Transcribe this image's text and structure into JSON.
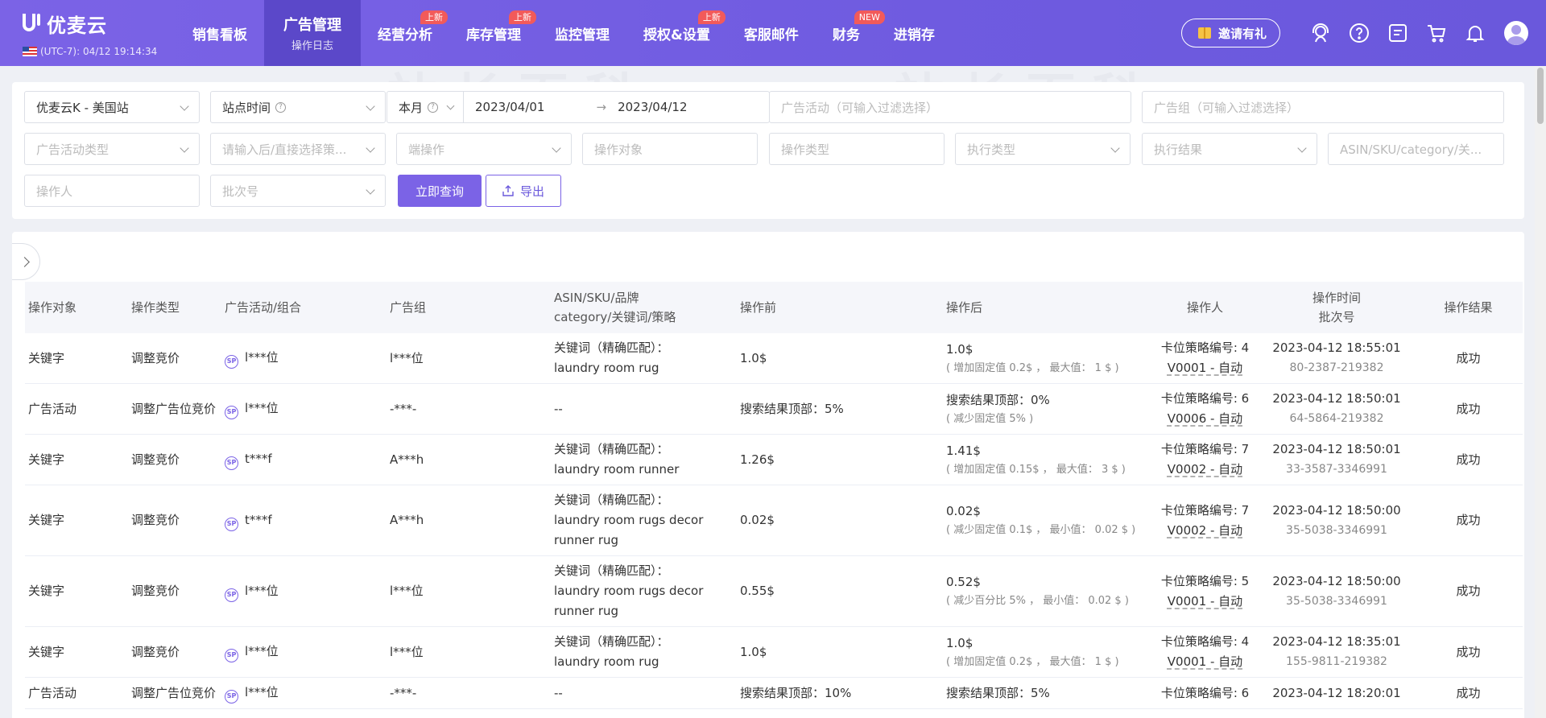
{
  "brand": {
    "name": "优麦云",
    "timezone": "(UTC-7): 04/12 19:14:34"
  },
  "nav": [
    {
      "label": "销售看板",
      "badge": ""
    },
    {
      "label": "广告管理",
      "sub": "操作日志",
      "active": true
    },
    {
      "label": "经营分析",
      "badge": "上新"
    },
    {
      "label": "库存管理",
      "badge": "上新"
    },
    {
      "label": "监控管理",
      "badge": ""
    },
    {
      "label": "授权&设置",
      "badge": "上新"
    },
    {
      "label": "客服邮件",
      "badge": ""
    },
    {
      "label": "财务",
      "badge": "NEW"
    },
    {
      "label": "进销存",
      "badge": ""
    }
  ],
  "top_right": {
    "invite": "邀请有礼",
    "icons": [
      "support-icon",
      "help-icon",
      "message-icon",
      "cart-icon",
      "bell-icon",
      "user-avatar"
    ]
  },
  "filters": {
    "store": "优麦云K - 美国站",
    "time_type": "站点时间",
    "period": "本月",
    "date_start": "2023/04/01",
    "date_end": "2023/04/12",
    "campaign_placeholder": "广告活动（可输入过滤选择）",
    "group_placeholder": "广告组（可输入过滤选择）",
    "campaign_type_placeholder": "广告活动类型",
    "strategy_placeholder": "请输入后/直接选择策...",
    "endpoint_placeholder": "端操作",
    "target_placeholder": "操作对象",
    "op_type_placeholder": "操作类型",
    "exec_type_placeholder": "执行类型",
    "exec_result_placeholder": "执行结果",
    "asin_placeholder": "ASIN/SKU/category/关...",
    "operator_placeholder": "操作人",
    "batch_placeholder": "批次号",
    "query_button": "立即查询",
    "export_button": "导出"
  },
  "table": {
    "headers": {
      "target": "操作对象",
      "op_type": "操作类型",
      "campaign": "广告活动/组合",
      "group": "广告组",
      "asin_line1": "ASIN/SKU/品牌",
      "asin_line2": "category/关键词/策略",
      "before": "操作前",
      "after": "操作后",
      "operator": "操作人",
      "time_line1": "操作时间",
      "time_line2": "批次号",
      "result": "操作结果"
    },
    "rows": [
      {
        "target": "关键字",
        "op_type": "调整竞价",
        "campaign": "l***位",
        "group": "l***位",
        "asin_line1": "关键词（精确匹配）：",
        "asin_line2": "laundry room rug",
        "before": "1.0$",
        "after": "1.0$",
        "after_note": "( 增加固定值 0.2$ ， 最大值： 1 $ )",
        "operator": "卡位策略编号: 4",
        "strategy": "V0001 - 自动",
        "time": "2023-04-12 18:55:01",
        "batch": "80-2387-219382",
        "result": "成功"
      },
      {
        "target": "广告活动",
        "op_type": "调整广告位竞价",
        "campaign": "l***位",
        "group": "-***-",
        "asin_line1": "--",
        "asin_line2": "",
        "before": "搜索结果顶部：5%",
        "after": "搜索结果顶部：0%",
        "after_note": "( 减少固定值 5% )",
        "operator": "卡位策略编号: 6",
        "strategy": "V0006 - 自动",
        "time": "2023-04-12 18:50:01",
        "batch": "64-5864-219382",
        "result": "成功"
      },
      {
        "target": "关键字",
        "op_type": "调整竞价",
        "campaign": "t***f",
        "group": "A***h",
        "asin_line1": "关键词（精确匹配）：",
        "asin_line2": "laundry room runner",
        "before": "1.26$",
        "after": "1.41$",
        "after_note": "( 增加固定值 0.15$ ， 最大值： 3 $ )",
        "operator": "卡位策略编号: 7",
        "strategy": "V0002 - 自动",
        "time": "2023-04-12 18:50:01",
        "batch": "33-3587-3346991",
        "result": "成功"
      },
      {
        "target": "关键字",
        "op_type": "调整竞价",
        "campaign": "t***f",
        "group": "A***h",
        "asin_line1": "关键词（精确匹配）：",
        "asin_line2": "laundry room rugs decor runner rug",
        "before": "0.02$",
        "after": "0.02$",
        "after_note": "( 减少固定值 0.1$ ， 最小值： 0.02 $ )",
        "operator": "卡位策略编号: 7",
        "strategy": "V0002 - 自动",
        "time": "2023-04-12 18:50:00",
        "batch": "35-5038-3346991",
        "result": "成功"
      },
      {
        "target": "关键字",
        "op_type": "调整竞价",
        "campaign": "l***位",
        "group": "l***位",
        "asin_line1": "关键词（精确匹配）：",
        "asin_line2": "laundry room rugs decor runner rug",
        "before": "0.55$",
        "after": "0.52$",
        "after_note": "( 减少百分比 5% ， 最小值： 0.02 $ )",
        "operator": "卡位策略编号: 5",
        "strategy": "V0001 - 自动",
        "time": "2023-04-12 18:50:00",
        "batch": "35-5038-3346991",
        "result": "成功"
      },
      {
        "target": "关键字",
        "op_type": "调整竞价",
        "campaign": "l***位",
        "group": "l***位",
        "asin_line1": "关键词（精确匹配）：",
        "asin_line2": "laundry room rug",
        "before": "1.0$",
        "after": "1.0$",
        "after_note": "( 增加固定值 0.2$ ， 最大值： 1 $ )",
        "operator": "卡位策略编号: 4",
        "strategy": "V0001 - 自动",
        "time": "2023-04-12 18:35:01",
        "batch": "155-9811-219382",
        "result": "成功"
      },
      {
        "target": "广告活动",
        "op_type": "调整广告位竞价",
        "campaign": "l***位",
        "group": "-***-",
        "asin_line1": "--",
        "asin_line2": "",
        "before": "搜索结果顶部：10%",
        "after": "搜索结果顶部：5%",
        "after_note": "",
        "operator": "卡位策略编号: 6",
        "strategy": "",
        "time": "2023-04-12 18:20:01",
        "batch": "",
        "result": "成功"
      }
    ]
  },
  "colors": {
    "primary": "#7b63e6",
    "nav_active": "#5b48c9",
    "badge": "#f25a5a"
  }
}
